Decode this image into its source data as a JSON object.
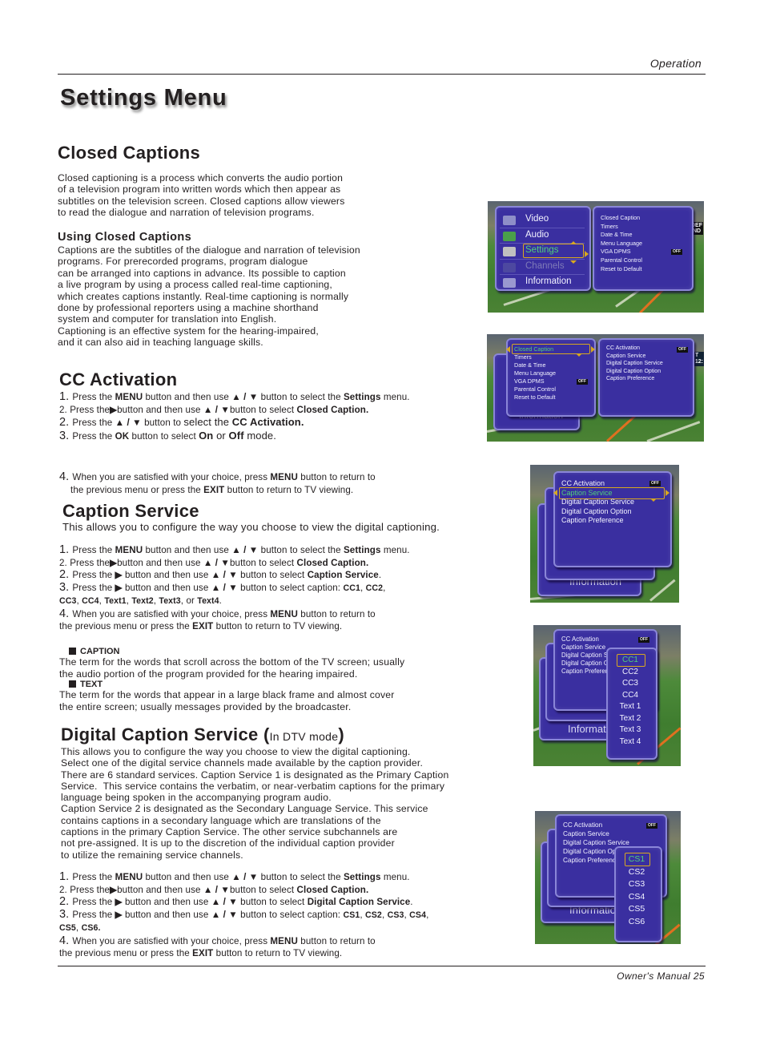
{
  "header": {
    "section_label": "Operation"
  },
  "page_title": "Settings Menu",
  "closed_captions": {
    "heading": "Closed Captions",
    "intro_lines": [
      "Closed captioning is a process which converts the audio portion",
      "of a television program into written words which then appear as",
      "subtitles on the television screen. Closed captions allow viewers",
      "to read the dialogue and narration of television programs."
    ],
    "using_heading": "Using Closed Captions",
    "using_lines": [
      "Captions are the subtitles of the dialogue and narration of television",
      "programs. For prerecorded programs, program dialogue",
      "can be arranged into captions in advance. Its possible to caption",
      "a live program by using a process called real-time captioning,",
      "which creates captions instantly. Real-time captioning is normally",
      "done by professional reporters using a machine shorthand",
      "system and computer for translation into English.",
      "Captioning is an effective system for the hearing-impaired,",
      "and it can also aid in teaching language skills."
    ]
  },
  "cc_activation": {
    "heading": "CC Activation",
    "steps": [
      {
        "num": "1.",
        "parts": [
          [
            "Press the ",
            0
          ],
          [
            "MENU",
            1
          ],
          [
            " button and then use ",
            0
          ],
          [
            "▲ / ▼",
            1
          ],
          [
            "  button to select the ",
            0
          ],
          [
            "Settings",
            1
          ],
          [
            " menu.",
            0
          ]
        ]
      },
      {
        "num": "2.",
        "small_num": true,
        "parts": [
          [
            "Press the",
            0
          ],
          [
            "▶",
            1
          ],
          [
            "button and then use ",
            0
          ],
          [
            "▲ / ▼",
            1
          ],
          [
            "button to select ",
            0
          ],
          [
            "Closed Caption.",
            1
          ]
        ]
      },
      {
        "num": "2.",
        "parts": [
          [
            "Press the ",
            0
          ],
          [
            "▲ / ▼",
            1
          ],
          [
            " button to ",
            0
          ],
          [
            "select the ",
            2
          ],
          [
            "CC Activation.",
            3
          ]
        ]
      },
      {
        "num": "3.",
        "parts": [
          [
            "Press the ",
            0
          ],
          [
            "OK",
            1
          ],
          [
            " button to select ",
            0
          ],
          [
            "On",
            3
          ],
          [
            " or ",
            2
          ],
          [
            "Off",
            3
          ],
          [
            " mode.",
            2
          ]
        ]
      }
    ],
    "final_step": {
      "num": "4.",
      "line1": [
        [
          "When you are satisfied with your choice,  press ",
          0
        ],
        [
          "MENU",
          1
        ],
        [
          " button to return to",
          0
        ]
      ],
      "line2": [
        [
          "the previous menu or press the ",
          0
        ],
        [
          "EXIT",
          1
        ],
        [
          " button to return to TV viewing.",
          0
        ]
      ]
    }
  },
  "caption_service": {
    "heading": "Caption Service",
    "intro": "This allows you to configure the way you choose to view the digital captioning.",
    "steps": [
      {
        "num": "1.",
        "parts": [
          [
            "Press the ",
            0
          ],
          [
            "MENU",
            1
          ],
          [
            " button and then use ",
            0
          ],
          [
            "▲ / ▼",
            1
          ],
          [
            "  button to select the ",
            0
          ],
          [
            "Settings",
            1
          ],
          [
            " menu.",
            0
          ]
        ]
      },
      {
        "num": "2.",
        "small_num": true,
        "parts": [
          [
            "Press the",
            0
          ],
          [
            "▶",
            1
          ],
          [
            "button and then use ",
            0
          ],
          [
            "▲ / ▼",
            1
          ],
          [
            "button to select ",
            0
          ],
          [
            "Closed Caption.",
            1
          ]
        ]
      },
      {
        "num": "2.",
        "parts": [
          [
            "Press the ",
            0
          ],
          [
            "▶",
            1
          ],
          [
            "  button and then use ",
            0
          ],
          [
            "▲ / ▼",
            1
          ],
          [
            "  button to select ",
            0
          ],
          [
            "Caption Service",
            1
          ],
          [
            ".",
            0
          ]
        ]
      },
      {
        "num": "3.",
        "parts": [
          [
            "Press the ",
            0
          ],
          [
            "▶",
            1
          ],
          [
            "  button and then use ",
            0
          ],
          [
            "▲ / ▼",
            1
          ],
          [
            "  button to select caption: ",
            0
          ],
          [
            "CC1",
            4
          ],
          [
            ", ",
            0
          ],
          [
            "CC2",
            4
          ],
          [
            ",",
            0
          ]
        ]
      },
      {
        "num": "",
        "cont": true,
        "parts": [
          [
            "CC3",
            4
          ],
          [
            ", ",
            0
          ],
          [
            "CC4",
            4
          ],
          [
            ", ",
            0
          ],
          [
            "Text1",
            4
          ],
          [
            ", ",
            0
          ],
          [
            "Text2",
            4
          ],
          [
            ", ",
            0
          ],
          [
            "Text3",
            4
          ],
          [
            ", or ",
            0
          ],
          [
            "Text4",
            4
          ],
          [
            ".",
            0
          ]
        ]
      },
      {
        "num": "4.",
        "parts": [
          [
            "When you are satisfied with your choice,  press ",
            0
          ],
          [
            "MENU",
            1
          ],
          [
            " button to return to",
            0
          ]
        ]
      },
      {
        "num": "",
        "cont": true,
        "parts": [
          [
            "the previous menu or press the ",
            0
          ],
          [
            "EXIT",
            1
          ],
          [
            " button to return to TV viewing.",
            0
          ]
        ]
      }
    ],
    "terms": [
      {
        "label": "CAPTION",
        "lines": [
          "The term for the words that scroll across the bottom of the TV screen; usually",
          "the audio portion of the program provided for the hearing impaired."
        ]
      },
      {
        "label": "TEXT",
        "lines": [
          "The term for the words that appear in a large black frame and almost cover",
          "the entire screen; usually messages provided by the broadcaster."
        ]
      }
    ]
  },
  "digital_caption_service": {
    "heading": "Digital Caption Service",
    "heading_open": "(",
    "heading_sub": "In DTV mode",
    "heading_close": ")",
    "intro_lines": [
      "This allows you to configure the way you choose to view the digital captioning.",
      "Select one of the digital service channels made available by the caption provider.",
      "There are 6 standard services. Caption Service 1 is designated as the Primary Caption",
      "Service.  This service contains the verbatim, or near-verbatim captions for the primary",
      "language being spoken in the accompanying program audio.",
      "Caption Service 2 is designated as the Secondary Language Service. This service",
      "contains captions in a secondary language which are translations of the",
      "captions in the primary Caption Service. The other service subchannels are",
      "not pre-assigned. It is up to the discretion of the individual caption provider",
      "to utilize the remaining service channels."
    ],
    "steps": [
      {
        "num": "1.",
        "parts": [
          [
            "Press the ",
            0
          ],
          [
            "MENU",
            1
          ],
          [
            " button and then use ",
            0
          ],
          [
            "▲ / ▼",
            1
          ],
          [
            "  button to select the ",
            0
          ],
          [
            "Settings",
            1
          ],
          [
            " menu.",
            0
          ]
        ]
      },
      {
        "num": "2.",
        "small_num": true,
        "parts": [
          [
            "Press the",
            0
          ],
          [
            "▶",
            1
          ],
          [
            "button and then use ",
            0
          ],
          [
            "▲ / ▼",
            1
          ],
          [
            "button to select ",
            0
          ],
          [
            "Closed Caption.",
            1
          ]
        ]
      },
      {
        "num": "2.",
        "parts": [
          [
            "Press the ",
            0
          ],
          [
            "▶",
            1
          ],
          [
            "  button and then use ",
            0
          ],
          [
            "▲ / ▼",
            1
          ],
          [
            "  button to select ",
            0
          ],
          [
            "Digital Caption Service",
            1
          ],
          [
            ".",
            0
          ]
        ]
      },
      {
        "num": "3.",
        "parts": [
          [
            "Press the ",
            0
          ],
          [
            "▶",
            1
          ],
          [
            "  button and then use ",
            0
          ],
          [
            "▲ / ▼",
            1
          ],
          [
            "  button to select caption: ",
            0
          ],
          [
            "CS1",
            4
          ],
          [
            ", ",
            0
          ],
          [
            "CS2",
            4
          ],
          [
            ", ",
            0
          ],
          [
            "CS3",
            4
          ],
          [
            ", ",
            0
          ],
          [
            "CS4",
            4
          ],
          [
            ",",
            0
          ]
        ]
      },
      {
        "num": "",
        "cont": true,
        "parts": [
          [
            "CS5",
            4
          ],
          [
            ", ",
            0
          ],
          [
            "CS6.",
            4
          ]
        ]
      },
      {
        "num": "4.",
        "parts": [
          [
            "When you are satisfied with your choice,  press ",
            0
          ],
          [
            "MENU",
            1
          ],
          [
            " button to return to",
            0
          ]
        ]
      },
      {
        "num": "",
        "cont": true,
        "parts": [
          [
            "the previous menu or press the ",
            0
          ],
          [
            "EXIT",
            1
          ],
          [
            " button to return to TV viewing.",
            0
          ]
        ]
      }
    ]
  },
  "screens": {
    "main_menu": {
      "items": [
        "Video",
        "Audio",
        "Settings",
        "Channels",
        "Information"
      ],
      "selected": "Settings",
      "disabled": [
        "Channels"
      ]
    },
    "settings_menu": {
      "items": [
        "Closed Caption",
        "Timers",
        "Date & Time",
        "Menu Language",
        "VGA DPMS",
        "Parental Control",
        "Reset to Default"
      ],
      "selected": "Closed Caption",
      "vga_dpms_value": "OFF"
    },
    "closed_caption_menu": {
      "items": [
        "CC Activation",
        "Caption Service",
        "Digital Caption Service",
        "Digital Caption Option",
        "Caption Preference"
      ],
      "cc_activation_value": "OFF"
    },
    "caption_service_options": [
      "CC1",
      "CC2",
      "CC3",
      "CC4",
      "Text 1",
      "Text 2",
      "Text 3",
      "Text 4"
    ],
    "caption_service_selected": "CC1",
    "digital_caption_options": [
      "CS1",
      "CS2",
      "CS3",
      "CS4",
      "CS5",
      "CS6"
    ],
    "digital_caption_selected": "CS1",
    "background_text_1": [
      "DEF",
      "IND"
    ],
    "background_text_2": [
      "T",
      "12:"
    ],
    "info_label": "Information"
  },
  "footer": {
    "label": "Owner's Manual",
    "page": "25"
  },
  "colors": {
    "menu_bg": "#3a2fa0",
    "menu_border": "#8a86d8",
    "highlight_border": "#d8a820",
    "selected_text": "#4fd07a"
  }
}
